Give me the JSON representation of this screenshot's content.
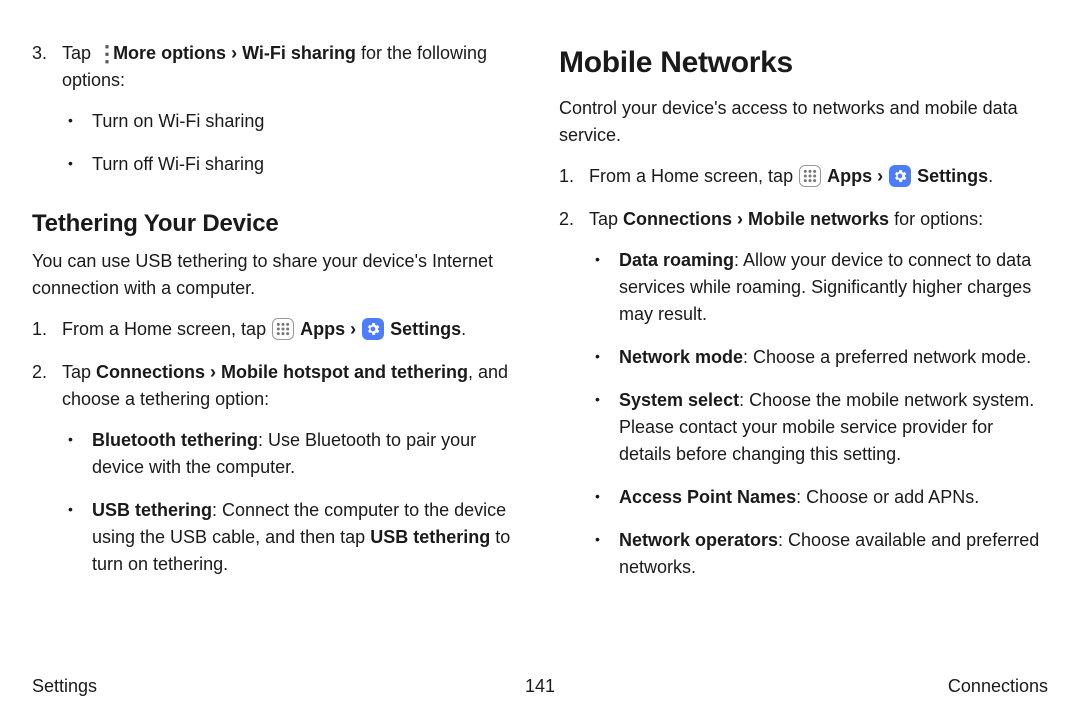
{
  "left": {
    "step3_pre": "Tap",
    "step3_mid1": "More options",
    "step3_chev": "›",
    "step3_mid2": "Wi-Fi sharing",
    "step3_post": " for the following options:",
    "step3_b1": "Turn on Wi-Fi sharing",
    "step3_b2": "Turn off Wi-Fi sharing",
    "h2": "Tethering Your Device",
    "intro": "You can use USB tethering to share your device's Internet connection with a computer.",
    "s1_pre": "From a Home screen, tap",
    "apps_label": "Apps",
    "settings_label": "Settings",
    "period": ".",
    "s2_pre": "Tap ",
    "s2_bold": "Connections › Mobile hotspot and tethering",
    "s2_post": ", and choose a tethering option:",
    "b1_bold": "Bluetooth tethering",
    "b1_rest": ": Use Bluetooth to pair your device with the computer.",
    "b2_bold": "USB tethering",
    "b2_mid": ": Connect the computer to the device using the USB cable, and then tap ",
    "b2_bold2": "USB tethering",
    "b2_end": " to turn on tethering."
  },
  "right": {
    "h1": "Mobile Networks",
    "intro": "Control your device's access to networks and mobile data service.",
    "s1_pre": "From a Home screen, tap",
    "apps_label": "Apps",
    "chev": "›",
    "settings_label": "Settings",
    "period": ".",
    "s2_pre": "Tap ",
    "s2_bold": "Connections › Mobile networks",
    "s2_post": " for options:",
    "b1_bold": "Data roaming",
    "b1_rest": ": Allow your device to connect to data services while roaming. Significantly higher charges may result.",
    "b2_bold": "Network mode",
    "b2_rest": ": Choose a preferred network mode.",
    "b3_bold": "System select",
    "b3_rest": ": Choose the mobile network system. Please contact your mobile service provider for details before changing this setting.",
    "b4_bold": "Access Point Names",
    "b4_rest": ": Choose or add APNs.",
    "b5_bold": "Network operators",
    "b5_rest": ": Choose available and preferred networks."
  },
  "footer": {
    "left": "Settings",
    "center": "141",
    "right": "Connections"
  }
}
